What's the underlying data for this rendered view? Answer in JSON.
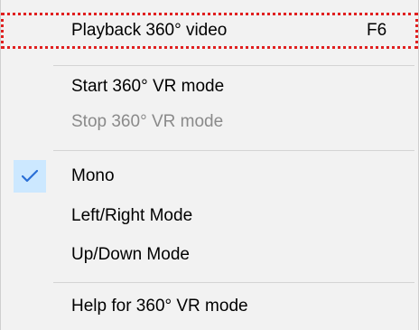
{
  "menu": {
    "items": [
      {
        "label": "Playback 360° video",
        "shortcut": "F6"
      },
      {
        "label": "Start 360° VR mode"
      },
      {
        "label": "Stop 360° VR mode",
        "disabled": true
      },
      {
        "label": "Mono",
        "checked": true
      },
      {
        "label": "Left/Right Mode"
      },
      {
        "label": "Up/Down Mode"
      },
      {
        "label": "Help for 360° VR mode"
      }
    ]
  },
  "icons": {
    "check": "checkmark-icon"
  },
  "colors": {
    "background": "#f2f2f2",
    "focus_outline": "#e02020",
    "disabled_text": "#8a8a8a",
    "check_highlight": "#cce8ff",
    "check_mark": "#2a6fd6"
  }
}
